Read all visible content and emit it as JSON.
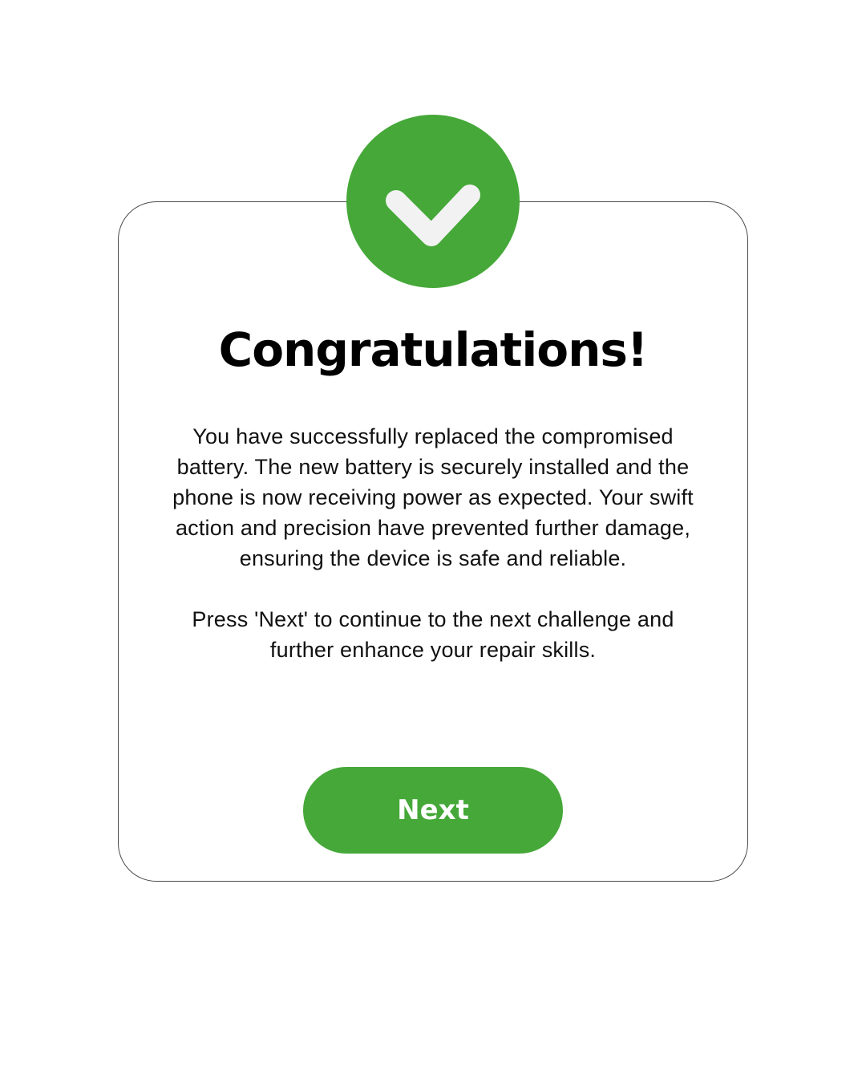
{
  "dialog": {
    "title": "Congratulations!",
    "paragraphs": [
      "You have successfully replaced the compromised battery. The new battery is securely installed and the phone is now receiving power as expected. Your swift action and precision have prevented further damage, ensuring the device is safe and reliable.",
      "Press 'Next' to continue to the next challenge and further enhance your repair skills."
    ],
    "next_label": "Next",
    "icon": "checkmark-icon"
  },
  "colors": {
    "accent": "#45a838",
    "checkmark": "#f2f2f2",
    "text": "#111111",
    "border": "#4a4a4a"
  }
}
